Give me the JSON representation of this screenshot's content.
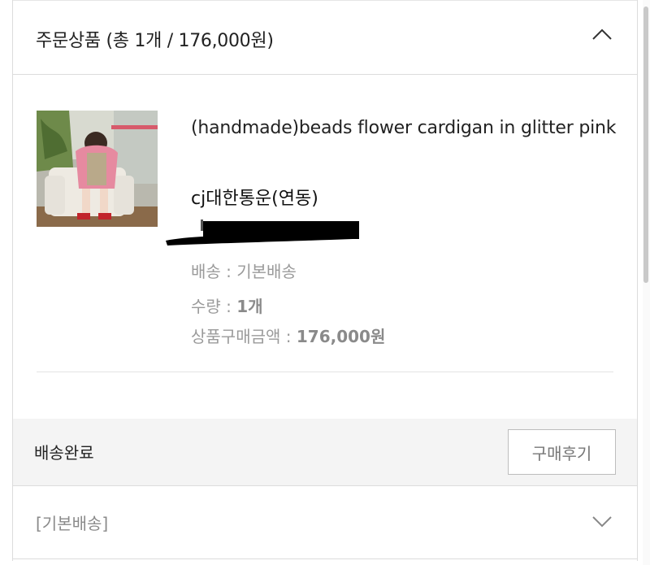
{
  "order": {
    "header_title": "주문상품 (총 1개 / 176,000원)",
    "collapse_icon": "chevron-up-icon"
  },
  "product": {
    "name": "(handmade)beads flower cardigan in glitter pink",
    "carrier": "cj대한통운(연동)",
    "image_desc_icon": "product-thumbnail",
    "shipping_label": "배송 : 기본배송",
    "quantity_label": "수량 : ",
    "quantity_value": "1개",
    "price_label": "상품구매금액 : ",
    "price_value": "176,000원"
  },
  "status": {
    "text": "배송완료",
    "review_button": "구매후기"
  },
  "shipping_group": {
    "label": "[기본배송]",
    "expand_icon": "chevron-down-icon"
  },
  "colors": {
    "border": "#dcdcdc",
    "status_bg": "#f4f4f4",
    "muted_text": "#9a9a9a"
  }
}
